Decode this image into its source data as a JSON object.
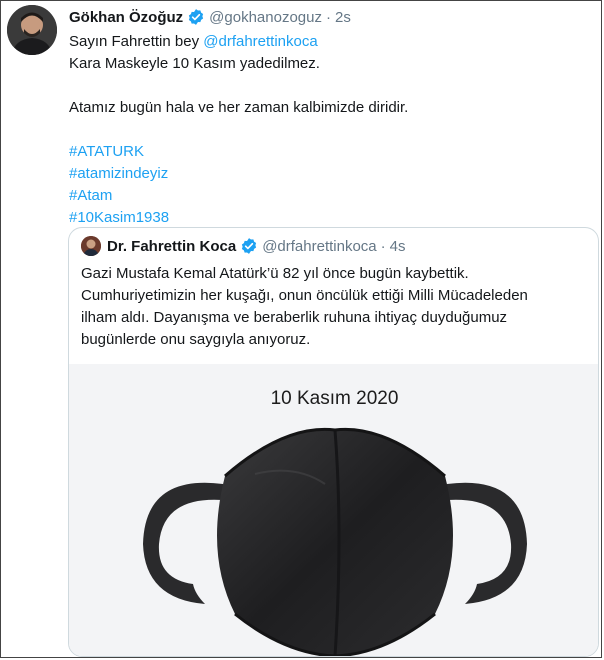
{
  "tweet": {
    "author_name": "Gökhan Özoğuz",
    "author_handle": "@gokhanozoguz",
    "separator": "·",
    "time": "2s",
    "lines": [
      {
        "pre": "Sayın Fahrettin bey ",
        "mention": "@drfahrettinkoca"
      },
      {
        "text": "Kara Maskeyle  10 Kasım yadedilmez."
      },
      {
        "text": "Atamız bugün hala ve her zaman  kalbimizde diridir."
      }
    ],
    "hashtags": [
      "#ATATURK",
      "#atamizindeyiz",
      "#Atam",
      "#10Kasim1938"
    ]
  },
  "quoted": {
    "author_name": "Dr. Fahrettin Koca",
    "author_handle": "@drfahrettinkoca",
    "separator": "·",
    "time": "4s",
    "lines": [
      "Gazi Mustafa Kemal Atatürk’ü 82 yıl önce bugün kaybettik.",
      "Cumhuriyetimizin her kuşağı, onun öncülük ettiği Milli Mücadeleden",
      "ilham aldı. Dayanışma ve beraberlik ruhuna ihtiyaç duyduğumuz",
      "bugünlerde onu saygıyla anıyoruz."
    ],
    "image_caption": "10 Kasım 2020"
  },
  "icons": {
    "verified": "verified-badge-icon",
    "mask": "black-face-mask-image"
  },
  "colors": {
    "link": "#1da1f2",
    "muted": "#657786",
    "verified": "#1da1f2"
  }
}
